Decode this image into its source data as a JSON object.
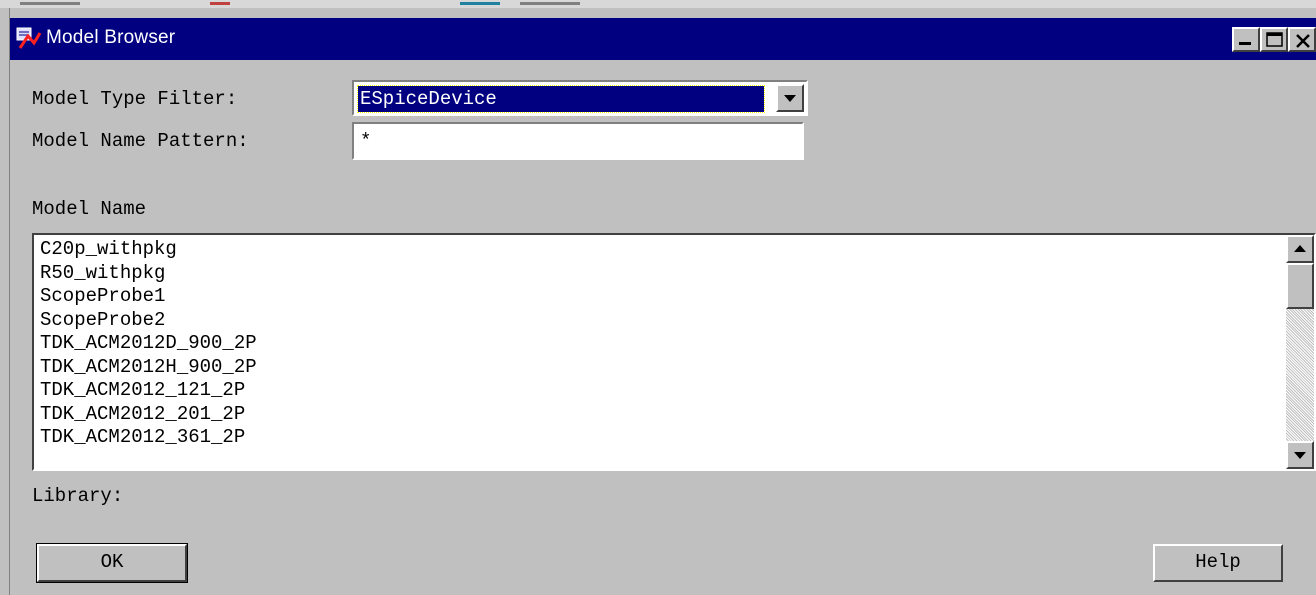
{
  "window": {
    "title": "Model Browser",
    "app_icon": "model-browser-app-icon",
    "controls": [
      "minimize-icon",
      "maximize-icon",
      "close-icon"
    ]
  },
  "filter": {
    "type_label": "Model Type Filter:",
    "type_value": "ESpiceDevice",
    "name_pattern_label": "Model Name Pattern:",
    "name_pattern_value": "*"
  },
  "list": {
    "header": "Model Name",
    "items": [
      "C20p_withpkg",
      "R50_withpkg",
      "ScopeProbe1",
      "ScopeProbe2",
      "TDK_ACM2012D_900_2P",
      "TDK_ACM2012H_900_2P",
      "TDK_ACM2012_121_2P",
      "TDK_ACM2012_201_2P",
      "TDK_ACM2012_361_2P"
    ]
  },
  "library": {
    "label": "Library:"
  },
  "buttons": {
    "ok": "OK",
    "help": "Help"
  },
  "colors": {
    "titlebar": "#000080",
    "face": "#c0c0c0",
    "selection": "#000080"
  }
}
